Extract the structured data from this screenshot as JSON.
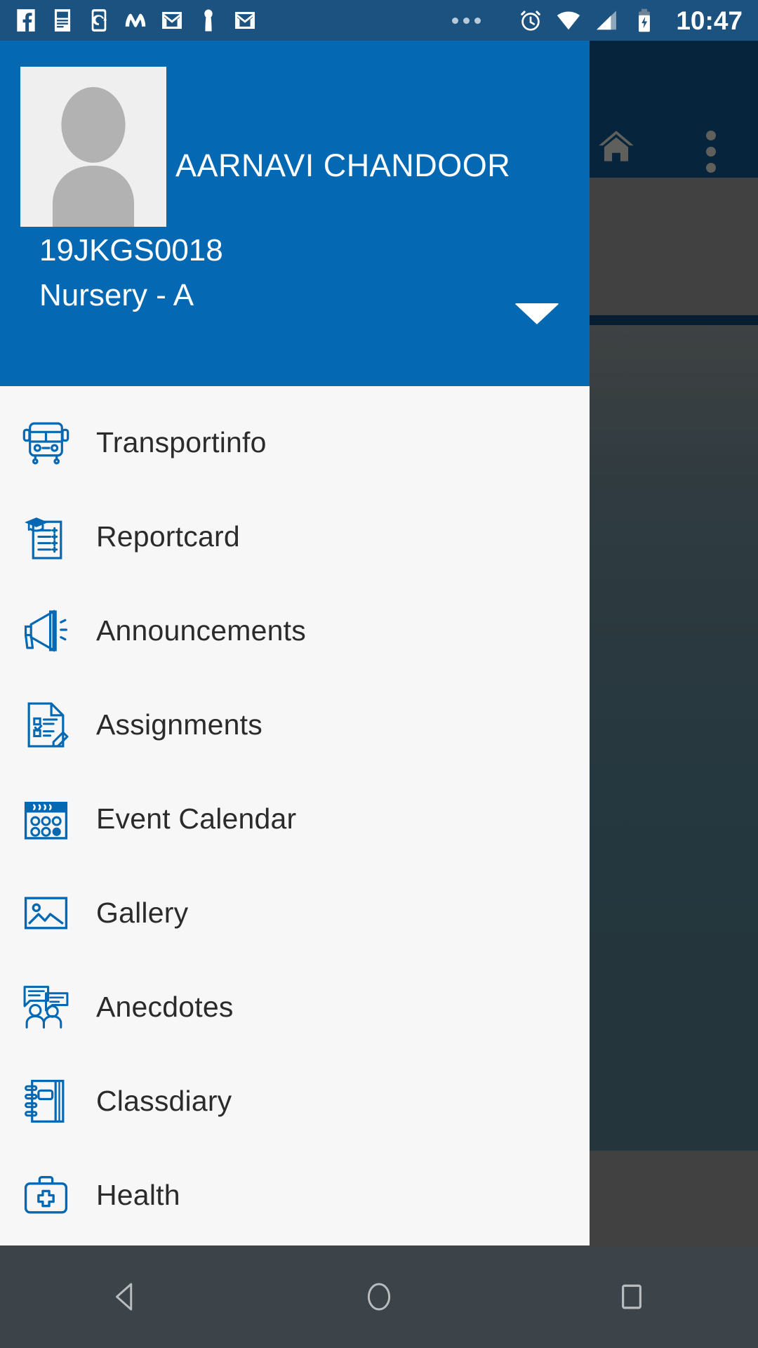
{
  "statusbar": {
    "time": "10:47",
    "left_icons": [
      {
        "name": "facebook-icon",
        "glyph": "f"
      },
      {
        "name": "news-document-icon",
        "glyph": ""
      },
      {
        "name": "phone-sync-icon",
        "glyph": ""
      },
      {
        "name": "messenger-m-icon",
        "glyph": "M"
      },
      {
        "name": "gmail-icon",
        "glyph": "M"
      },
      {
        "name": "person-badge-icon",
        "glyph": ""
      },
      {
        "name": "gmail-icon-2",
        "glyph": "M"
      }
    ],
    "overflow_label": "more notifications",
    "right_icons": [
      {
        "name": "alarm-clock-icon"
      },
      {
        "name": "wifi-icon"
      },
      {
        "name": "cellular-signal-icon"
      },
      {
        "name": "battery-charging-icon"
      }
    ],
    "background_color": "#1c5280"
  },
  "background_app": {
    "appbar_color": "#0c3a63",
    "home_icon": "home-icon",
    "overflow_icon": "overflow-menu-icon",
    "scrim_color": "rgba(0,0,0,0.38)"
  },
  "drawer": {
    "accent_color": "#0568b3",
    "list_background": "#f7f7f7",
    "header": {
      "avatar": "avatar-placeholder",
      "student_name": "AARNAVI CHANDOOR",
      "student_id": "19JKGS0018",
      "student_class": "Nursery - A",
      "caret": "chevron-down-icon"
    },
    "items": [
      {
        "label": "Transportinfo",
        "icon": "bus-icon",
        "name": "sidebar-item-transportinfo"
      },
      {
        "label": "Reportcard",
        "icon": "graduation-report-icon",
        "name": "sidebar-item-reportcard"
      },
      {
        "label": "Announcements",
        "icon": "megaphone-icon",
        "name": "sidebar-item-announcements"
      },
      {
        "label": "Assignments",
        "icon": "assignment-pencil-icon",
        "name": "sidebar-item-assignments"
      },
      {
        "label": "Event Calendar",
        "icon": "calendar-icon",
        "name": "sidebar-item-event-calendar"
      },
      {
        "label": "Gallery",
        "icon": "image-gallery-icon",
        "name": "sidebar-item-gallery"
      },
      {
        "label": "Anecdotes",
        "icon": "people-chat-icon",
        "name": "sidebar-item-anecdotes"
      },
      {
        "label": "Classdiary",
        "icon": "notebook-icon",
        "name": "sidebar-item-classdiary"
      },
      {
        "label": "Health",
        "icon": "first-aid-kit-icon",
        "name": "sidebar-item-health"
      }
    ]
  },
  "navbar": {
    "background_color": "#3c4449",
    "back_label": "Back",
    "home_label": "Home",
    "recents_label": "Recents"
  }
}
